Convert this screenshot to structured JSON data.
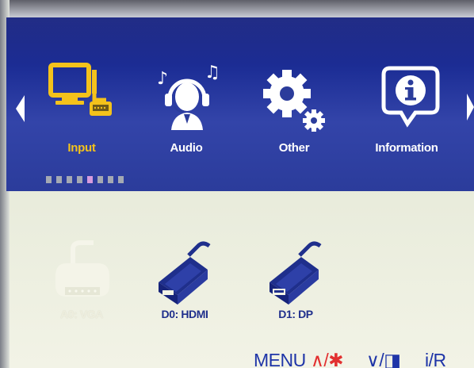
{
  "colors": {
    "menu_bar": "#1d2e96",
    "active_label": "#f4c21b",
    "inactive_label": "#ffffff",
    "source_label": "#1f2f8c",
    "hint_blue": "#1f35a8",
    "hint_red": "#e23030",
    "selected_dot": "#d69bde"
  },
  "tabs": [
    {
      "label": "Input",
      "icon": "monitor-input-icon",
      "active": true
    },
    {
      "label": "Audio",
      "icon": "headphones-person-icon",
      "active": false
    },
    {
      "label": "Other",
      "icon": "gears-icon",
      "active": false
    },
    {
      "label": "Information",
      "icon": "info-bubble-icon",
      "active": false
    }
  ],
  "page_indicator": {
    "count": 8,
    "selected": 5
  },
  "sources": [
    {
      "label": "A0: VGA",
      "icon": "vga-connector-icon",
      "enabled": false
    },
    {
      "label": "D0: HDMI",
      "icon": "hdmi-connector-icon",
      "enabled": true
    },
    {
      "label": "D1: DP",
      "icon": "displayport-connector-icon",
      "enabled": true
    }
  ],
  "hints": {
    "menu": "MENU",
    "up": "∧/✱",
    "down": "∨/◨",
    "right": "i/R"
  }
}
